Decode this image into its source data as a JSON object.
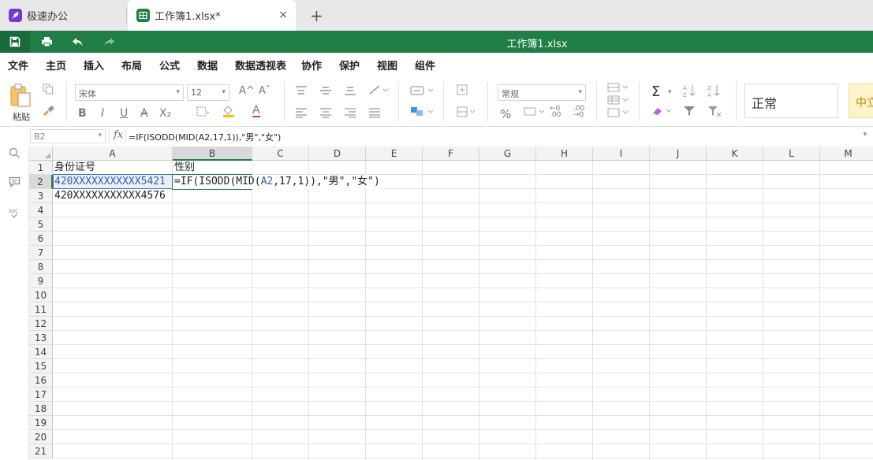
{
  "tabs": [
    {
      "label": "极速办公",
      "icon": "rocket-icon"
    },
    {
      "label": "工作簿1.xlsx*",
      "icon": "spreadsheet-icon",
      "close": "×"
    }
  ],
  "new_tab": "+",
  "title_bar": {
    "title": "工作簿1.xlsx"
  },
  "menus": [
    "文件",
    "主页",
    "插入",
    "布局",
    "公式",
    "数据",
    "数据透视表",
    "协作",
    "保护",
    "视图",
    "组件"
  ],
  "active_menu": "主页",
  "ribbon": {
    "paste_label": "粘贴",
    "font_name": "宋体",
    "font_size": "12",
    "number_format": "常规",
    "style_normal": "正常",
    "style_neutral": "中立",
    "font_buttons": {
      "bold": "B",
      "italic": "I",
      "underline": "U",
      "strike": "A",
      "sub": "X₂",
      "font_color": "A"
    },
    "grow": "A^",
    "shrink": "Aˇ",
    "sum": "Σ",
    "percent": "%"
  },
  "formula_bar": {
    "name_box": "B2",
    "fx": "fx",
    "formula": "=IF(ISODD(MID(A2,17,1)),\"男\",\"女\")"
  },
  "grid": {
    "columns": [
      "A",
      "B",
      "C",
      "D",
      "E",
      "F",
      "G",
      "H",
      "I",
      "J",
      "K",
      "L",
      "M"
    ],
    "rows": [
      "1",
      "2",
      "3",
      "4",
      "5",
      "6",
      "7",
      "8",
      "9",
      "10",
      "11",
      "12",
      "13",
      "14",
      "15",
      "16",
      "17",
      "18",
      "19",
      "20",
      "21"
    ],
    "selected_column": "B",
    "selected_row": "2",
    "cells": {
      "A1": "身份证号",
      "B1": "性别",
      "A2": "420XXXXXXXXXXX5421",
      "A3": "420XXXXXXXXXXX4576"
    },
    "edit_cell": {
      "ref": "B2",
      "prefix": "=IF(ISODD(MID(",
      "ref_token": "A2",
      "suffix": ",17,1)),\"男\",\"女\")"
    }
  },
  "colors": {
    "accent": "#1e7e45",
    "ref": "#3a5aa8"
  }
}
